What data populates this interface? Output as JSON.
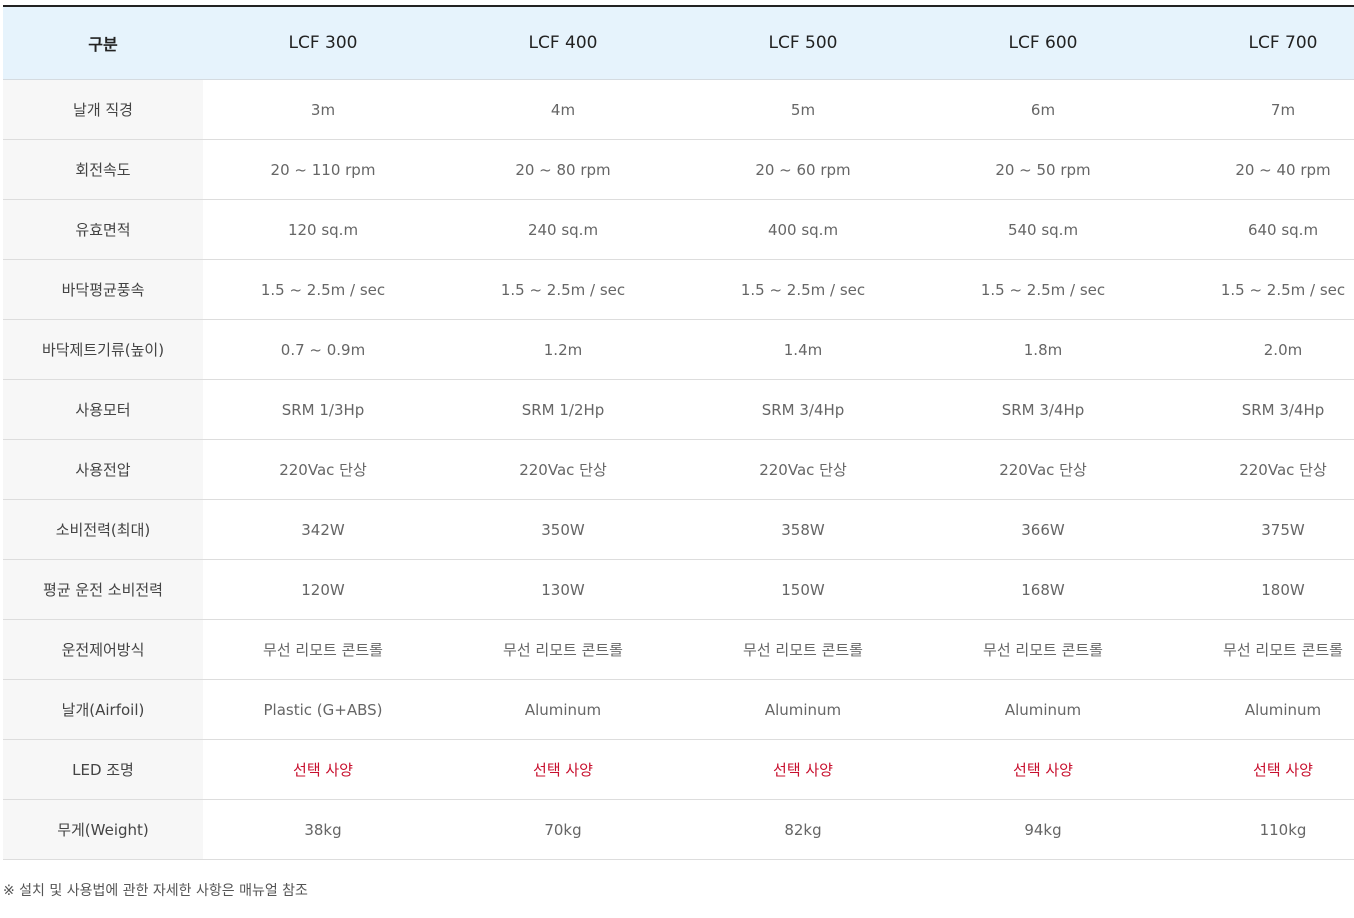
{
  "table": {
    "header": {
      "label": "구분",
      "models": [
        "LCF 300",
        "LCF 400",
        "LCF 500",
        "LCF 600",
        "LCF 700"
      ]
    },
    "highlight_color": "#c8102e",
    "rows": [
      {
        "label": "날개 직경",
        "values": [
          "3m",
          "4m",
          "5m",
          "6m",
          "7m"
        ],
        "highlight": false
      },
      {
        "label": "회전속도",
        "values": [
          "20 ~ 110 rpm",
          "20 ~ 80 rpm",
          "20 ~ 60 rpm",
          "20 ~ 50 rpm",
          "20 ~ 40 rpm"
        ],
        "highlight": false
      },
      {
        "label": "유효면적",
        "values": [
          "120 sq.m",
          "240 sq.m",
          "400 sq.m",
          "540 sq.m",
          "640 sq.m"
        ],
        "highlight": false
      },
      {
        "label": "바닥평균풍속",
        "values": [
          "1.5 ~ 2.5m / sec",
          "1.5 ~ 2.5m / sec",
          "1.5 ~ 2.5m / sec",
          "1.5 ~ 2.5m / sec",
          "1.5 ~ 2.5m / sec"
        ],
        "highlight": false
      },
      {
        "label": "바닥제트기류(높이)",
        "values": [
          "0.7 ~ 0.9m",
          "1.2m",
          "1.4m",
          "1.8m",
          "2.0m"
        ],
        "highlight": false
      },
      {
        "label": "사용모터",
        "values": [
          "SRM 1/3Hp",
          "SRM 1/2Hp",
          "SRM 3/4Hp",
          "SRM 3/4Hp",
          "SRM 3/4Hp"
        ],
        "highlight": false
      },
      {
        "label": "사용전압",
        "values": [
          "220Vac 단상",
          "220Vac 단상",
          "220Vac 단상",
          "220Vac 단상",
          "220Vac 단상"
        ],
        "highlight": false
      },
      {
        "label": "소비전력(최대)",
        "values": [
          "342W",
          "350W",
          "358W",
          "366W",
          "375W"
        ],
        "highlight": false
      },
      {
        "label": "평균 운전 소비전력",
        "values": [
          "120W",
          "130W",
          "150W",
          "168W",
          "180W"
        ],
        "highlight": false
      },
      {
        "label": "운전제어방식",
        "values": [
          "무선 리모트 콘트롤",
          "무선 리모트 콘트롤",
          "무선 리모트 콘트롤",
          "무선 리모트 콘트롤",
          "무선 리모트 콘트롤"
        ],
        "highlight": false
      },
      {
        "label": "날개(Airfoil)",
        "values": [
          "Plastic (G+ABS)",
          "Aluminum",
          "Aluminum",
          "Aluminum",
          "Aluminum"
        ],
        "highlight": false
      },
      {
        "label": "LED 조명",
        "values": [
          "선택 사양",
          "선택 사양",
          "선택 사양",
          "선택 사양",
          "선택 사양"
        ],
        "highlight": true
      },
      {
        "label": "무게(Weight)",
        "values": [
          "38kg",
          "70kg",
          "82kg",
          "94kg",
          "110kg"
        ],
        "highlight": false
      }
    ]
  },
  "footnote": "※ 설치 및 사용법에 관한 자세한 사항은 매뉴얼 참조"
}
